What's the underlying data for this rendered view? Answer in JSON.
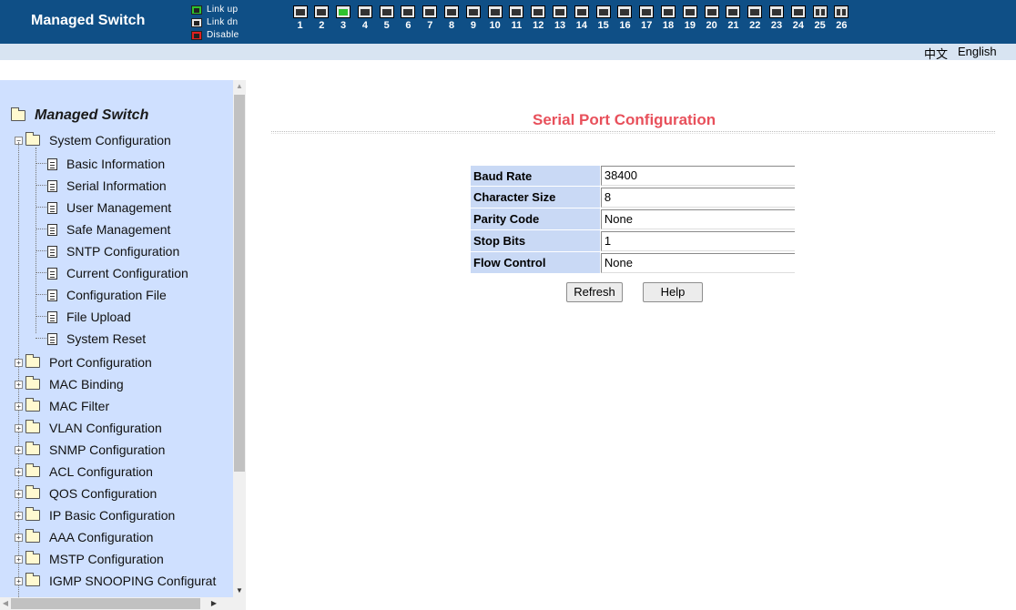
{
  "header": {
    "brand": "Managed Switch",
    "legend": [
      {
        "label": "Link up",
        "color": "#2fc22f"
      },
      {
        "label": "Link dn",
        "color": "#333333"
      },
      {
        "label": "Disable",
        "color": "#e02020"
      }
    ],
    "ports": [
      {
        "num": "1",
        "state": "down"
      },
      {
        "num": "2",
        "state": "down"
      },
      {
        "num": "3",
        "state": "up"
      },
      {
        "num": "4",
        "state": "down"
      },
      {
        "num": "5",
        "state": "down"
      },
      {
        "num": "6",
        "state": "down"
      },
      {
        "num": "7",
        "state": "down"
      },
      {
        "num": "8",
        "state": "down"
      },
      {
        "num": "9",
        "state": "down"
      },
      {
        "num": "10",
        "state": "down"
      },
      {
        "num": "11",
        "state": "down"
      },
      {
        "num": "12",
        "state": "down"
      },
      {
        "num": "13",
        "state": "down"
      },
      {
        "num": "14",
        "state": "down"
      },
      {
        "num": "15",
        "state": "down"
      },
      {
        "num": "16",
        "state": "down"
      },
      {
        "num": "17",
        "state": "down"
      },
      {
        "num": "18",
        "state": "down"
      },
      {
        "num": "19",
        "state": "down"
      },
      {
        "num": "20",
        "state": "down"
      },
      {
        "num": "21",
        "state": "down"
      },
      {
        "num": "22",
        "state": "down"
      },
      {
        "num": "23",
        "state": "down"
      },
      {
        "num": "24",
        "state": "down"
      },
      {
        "num": "25",
        "state": "down",
        "type": "fiber"
      },
      {
        "num": "26",
        "state": "down",
        "type": "fiber"
      }
    ]
  },
  "lang": {
    "zh": "中文",
    "en": "English"
  },
  "sidebar": {
    "root": "Managed Switch",
    "system_group": "System Configuration",
    "system_items": [
      "Basic Information",
      "Serial Information",
      "User Management",
      "Safe Management",
      "SNTP Configuration",
      "Current Configuration",
      "Configuration File",
      "File Upload",
      "System Reset"
    ],
    "groups": [
      "Port Configuration",
      "MAC Binding",
      "MAC Filter",
      "VLAN Configuration",
      "SNMP Configuration",
      "ACL Configuration",
      "QOS Configuration",
      "IP Basic Configuration",
      "AAA Configuration",
      "MSTP Configuration",
      "IGMP SNOOPING Configurat"
    ]
  },
  "main": {
    "title": "Serial Port Configuration",
    "rows": [
      {
        "label": "Baud Rate",
        "value": "38400"
      },
      {
        "label": "Character Size",
        "value": "8"
      },
      {
        "label": "Parity Code",
        "value": "None"
      },
      {
        "label": "Stop Bits",
        "value": "1"
      },
      {
        "label": "Flow Control",
        "value": "None"
      }
    ],
    "refresh_label": "Refresh",
    "help_label": "Help"
  }
}
